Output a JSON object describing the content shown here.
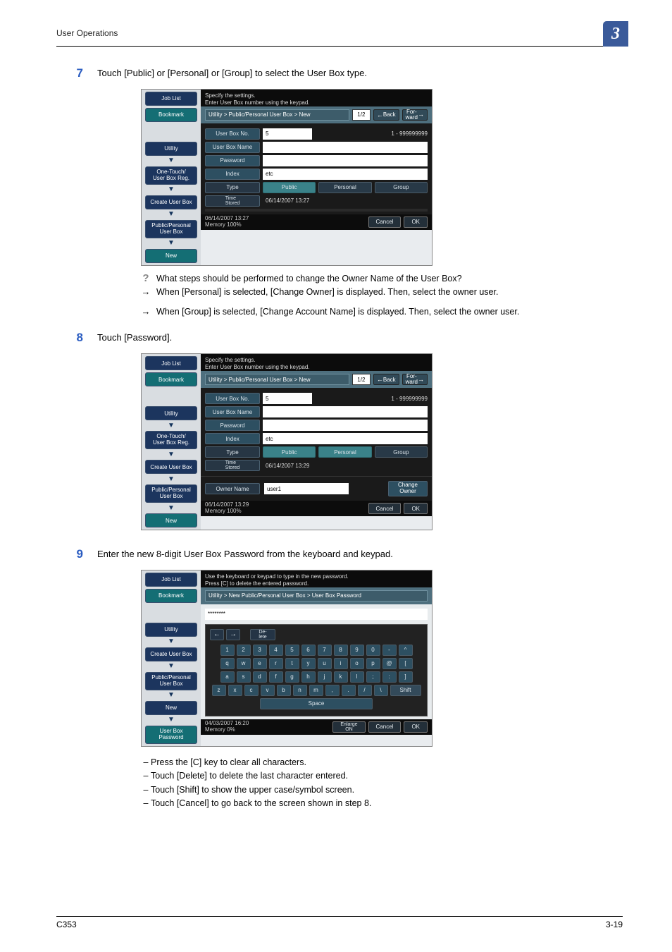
{
  "doc": {
    "header_title": "User Operations",
    "corner_number": "3",
    "footer_left": "C353",
    "footer_right": "3-19"
  },
  "step7": {
    "num": "7",
    "text": "Touch [Public] or [Personal] or [Group] to select the User Box type."
  },
  "step8": {
    "num": "8",
    "text": "Touch [Password]."
  },
  "step9": {
    "num": "9",
    "text": "Enter the new 8-digit User Box Password from the keyboard and keypad."
  },
  "notes7": {
    "q": "What steps should be performed to change the Owner Name of the User Box?",
    "a1": "When [Personal] is selected, [Change Owner] is displayed. Then, select the owner user.",
    "a2": "When [Group] is selected, [Change Account Name] is displayed. Then, select the owner user."
  },
  "bullets9": [
    "Press the [C] key to clear all characters.",
    "Touch [Delete] to delete the last character entered.",
    "Touch [Shift] to show the upper case/symbol screen.",
    "Touch [Cancel] to go back to the screen shown in step 8."
  ],
  "ss_common": {
    "nav": {
      "job_list": "Job List",
      "bookmark": "Bookmark",
      "utility": "Utility",
      "one_touch": "One-Touch/\nUser Box Reg.",
      "create": "Create User Box",
      "pp": "Public/Personal\nUser Box",
      "new": "New",
      "ub_pw": "User Box\nPassword"
    },
    "labels": {
      "box_no": "User Box No.",
      "box_name": "User Box Name",
      "password": "Password",
      "index": "Index",
      "type": "Type",
      "time_stored": "Time\nStored",
      "owner_name": "Owner Name",
      "change_owner": "Change\nOwner"
    },
    "btns": {
      "back": "Back",
      "forward": "For-\nward",
      "cancel": "Cancel",
      "ok": "OK",
      "public": "Public",
      "personal": "Personal",
      "group": "Group",
      "shift": "Shift",
      "space": "Space",
      "delete": "De-\nlete",
      "enlarge": "Enlarge\nON"
    }
  },
  "ss7": {
    "instr": "Specify the settings.\nEnter User Box number using the keypad.",
    "breadcrumb": "Utility > Public/Personal User Box > New",
    "page": "1/2",
    "box_no_val": "5",
    "range": "1 - 999999999",
    "index_val": "etc",
    "stored_val": "06/14/2007  13:27",
    "status_dt": "06/14/2007   13:27\nMemory        100%"
  },
  "ss8": {
    "instr": "Specify the settings.\nEnter User Box number using the keypad.",
    "breadcrumb": "Utility > Public/Personal User Box > New",
    "page": "1/2",
    "box_no_val": "5",
    "range": "1 - 999999999",
    "index_val": "etc",
    "stored_val": "06/14/2007  13:29",
    "owner_val": "user1",
    "status_dt": "06/14/2007   13:29\nMemory        100%"
  },
  "ss9": {
    "instr": "Use the keyboard or keypad to type in the new password.\nPress [C] to delete the entered password.",
    "breadcrumb": "Utility > New Public/Personal User Box > User Box Password",
    "pw_mask": "********",
    "status_dt": "04/03/2007   16:20\nMemory          0%",
    "rows": {
      "r1": [
        "1",
        "2",
        "3",
        "4",
        "5",
        "6",
        "7",
        "8",
        "9",
        "0",
        "-",
        "^"
      ],
      "r2": [
        "q",
        "w",
        "e",
        "r",
        "t",
        "y",
        "u",
        "i",
        "o",
        "p",
        "@",
        "["
      ],
      "r3": [
        "a",
        "s",
        "d",
        "f",
        "g",
        "h",
        "j",
        "k",
        "l",
        ";",
        ":",
        "]"
      ],
      "r4": [
        "z",
        "x",
        "c",
        "v",
        "b",
        "n",
        "m",
        ",",
        ".",
        "/",
        "\\"
      ]
    }
  }
}
